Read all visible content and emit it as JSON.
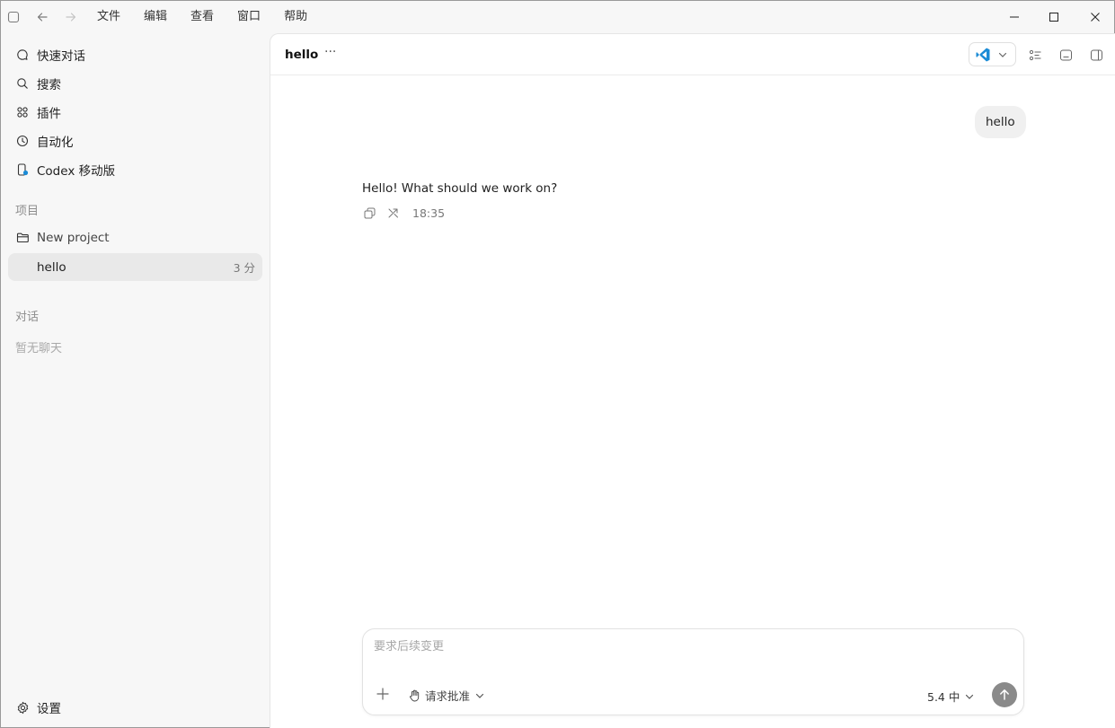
{
  "menu": {
    "items": [
      {
        "label": "文件"
      },
      {
        "label": "编辑"
      },
      {
        "label": "查看"
      },
      {
        "label": "窗口"
      },
      {
        "label": "帮助"
      }
    ]
  },
  "sidebar": {
    "nav": [
      {
        "label": "快速对话",
        "icon": "chat-bubble-icon"
      },
      {
        "label": "搜索",
        "icon": "search-icon"
      },
      {
        "label": "插件",
        "icon": "grid-icon"
      },
      {
        "label": "自动化",
        "icon": "clock-icon"
      },
      {
        "label": "Codex 移动版",
        "icon": "mobile-icon"
      }
    ],
    "projects_label": "项目",
    "projects": [
      {
        "label": "New project",
        "icon": "folder-icon"
      },
      {
        "label": "hello",
        "meta": "3 分",
        "active": true
      }
    ],
    "chats_label": "对话",
    "chats_empty": "暂无聊天",
    "settings_label": "设置"
  },
  "header": {
    "title": "hello",
    "more": "···"
  },
  "conversation": {
    "user_message": "hello",
    "assistant_message": "Hello! What should we work on?",
    "time": "18:35"
  },
  "composer": {
    "placeholder": "要求后续变更",
    "approval_label": "请求批准",
    "model_label": "5.4 中"
  },
  "colors": {
    "accent_blue": "#1b8bd6",
    "send_button": "#8a8a8a"
  }
}
